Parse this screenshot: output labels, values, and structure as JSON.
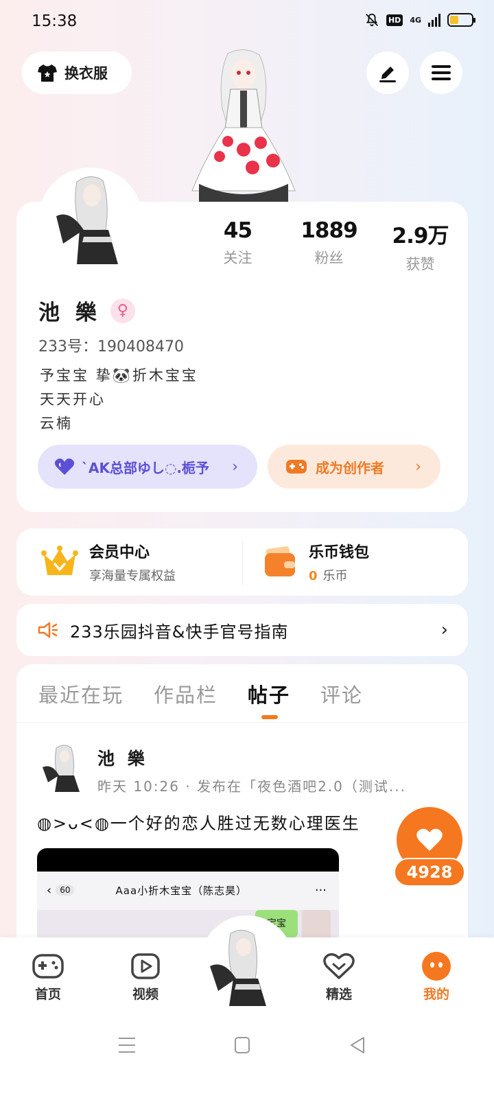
{
  "status_bar": {
    "time": "15:38",
    "hd_label": "HD",
    "network_label": "4G",
    "battery_level": 0.4
  },
  "top": {
    "outfit_label": "换衣服"
  },
  "profile": {
    "stats": [
      {
        "value": "45",
        "label": "关注"
      },
      {
        "value": "1889",
        "label": "粉丝"
      },
      {
        "value": "2.9万",
        "label": "获赞"
      }
    ],
    "name": "池 樂",
    "gender_symbol": "♀",
    "uid": "233号：190408470",
    "bio": [
      "予宝宝  挚🐼折木宝宝",
      "天天开心",
      "云楠"
    ],
    "guild_label": "`AK总部ゆし◌.栀予",
    "creator_label": "成为创作者"
  },
  "member": {
    "vip_title": "会员中心",
    "vip_sub": "享海量专属权益",
    "wallet_title": "乐币钱包",
    "wallet_amount": "0",
    "wallet_unit": "乐币"
  },
  "notice": {
    "text": "233乐园抖音&快手官号指南"
  },
  "tabs": [
    "最近在玩",
    "作品栏",
    "帖子",
    "评论"
  ],
  "active_tab": "帖子",
  "post": {
    "author": "池 樂",
    "meta": "昨天 10:26 · 发布在「夜色酒吧2.0（测试...",
    "text": "◍>ᴗ<◍一个好的恋人胜过无数心理医生",
    "image": {
      "back_count": "60",
      "chat_title": "Aaa小折木宝宝（陈志昊）",
      "more": "···",
      "bubble_text": "宝宝"
    },
    "likes": "4928"
  },
  "bottom_nav": [
    {
      "label": "首页",
      "icon": "gamepad-icon"
    },
    {
      "label": "视频",
      "icon": "play-icon"
    },
    {
      "label": "精选",
      "icon": "heart-badge-icon"
    },
    {
      "label": "我的",
      "icon": "me-face-icon"
    }
  ],
  "colors": {
    "accent": "#f5771f",
    "guild_text": "#5b50d6",
    "guild_bg": "#e5e2fb",
    "creator_bg": "#fde9dc",
    "gender": "#ea5d8b",
    "crown": "#f8b51b"
  }
}
